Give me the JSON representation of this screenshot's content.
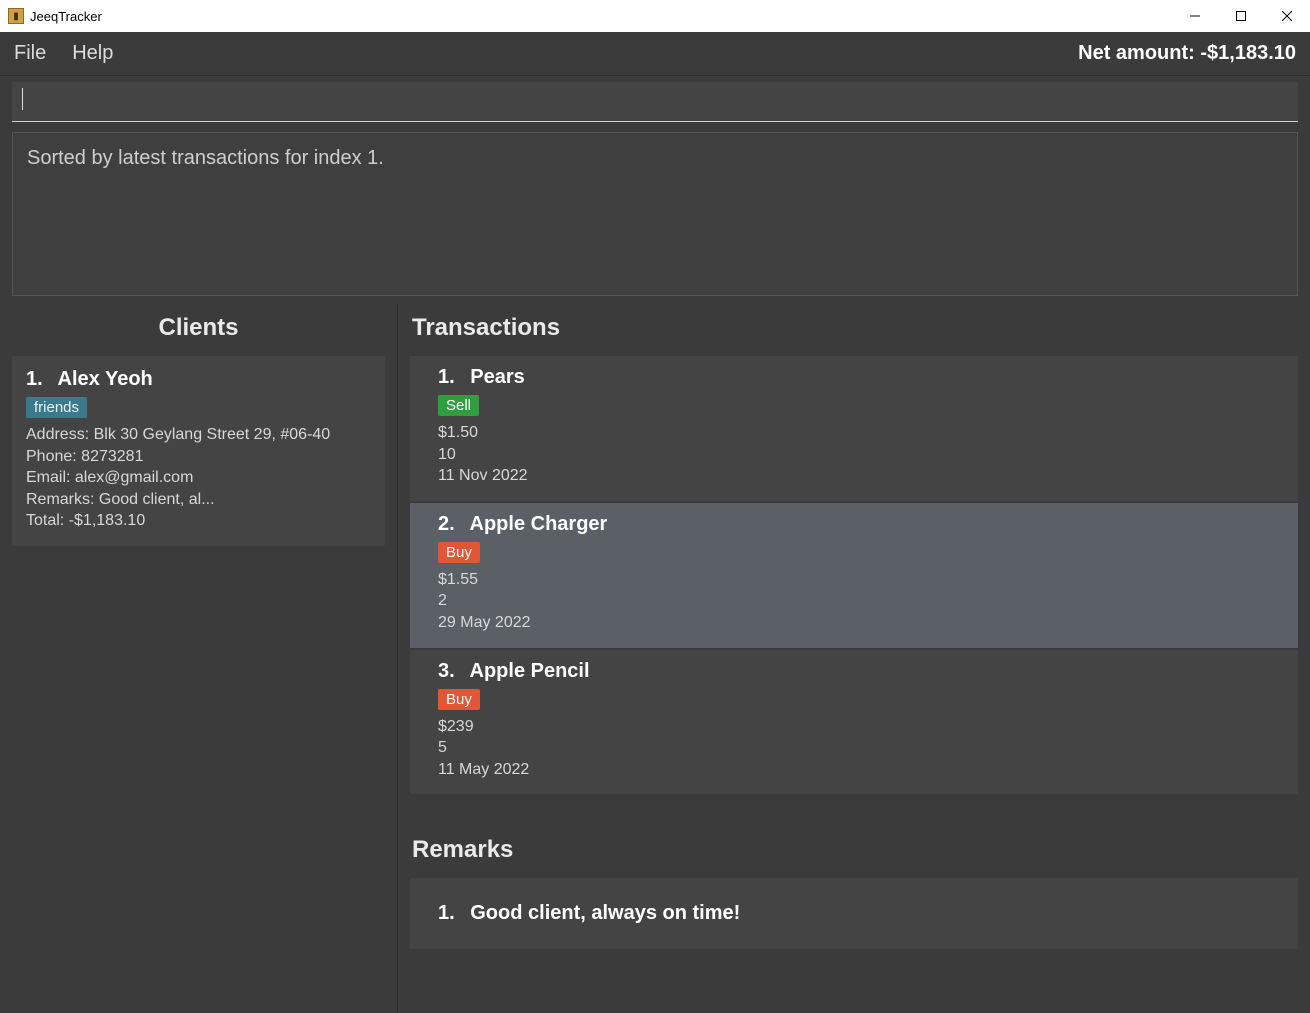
{
  "window": {
    "title": "JeeqTracker"
  },
  "menu": {
    "file": "File",
    "help": "Help"
  },
  "header": {
    "net_amount_label": "Net amount:",
    "net_amount_value": "-$1,183.10"
  },
  "command": {
    "value": ""
  },
  "status": {
    "message": "Sorted by latest transactions for index 1."
  },
  "clients": {
    "title": "Clients",
    "items": [
      {
        "index": "1.",
        "name": "Alex Yeoh",
        "tag": "friends",
        "address_label": "Address:",
        "address": "Blk 30 Geylang Street 29, #06-40",
        "phone_label": "Phone:",
        "phone": "8273281",
        "email_label": "Email:",
        "email": "alex@gmail.com",
        "remarks_label": "Remarks:",
        "remarks": "Good client, al...",
        "total_label": "Total:",
        "total": "-$1,183.10"
      }
    ]
  },
  "transactions": {
    "title": "Transactions",
    "items": [
      {
        "index": "1.",
        "name": "Pears",
        "type": "Sell",
        "price": "$1.50",
        "qty": "10",
        "date": "11 Nov 2022",
        "highlight": false
      },
      {
        "index": "2.",
        "name": "Apple Charger",
        "type": "Buy",
        "price": "$1.55",
        "qty": "2",
        "date": "29 May 2022",
        "highlight": true
      },
      {
        "index": "3.",
        "name": "Apple Pencil",
        "type": "Buy",
        "price": "$239",
        "qty": "5",
        "date": "11 May 2022",
        "highlight": false
      }
    ]
  },
  "remarks": {
    "title": "Remarks",
    "items": [
      {
        "index": "1.",
        "text": "Good client, always on time!"
      }
    ]
  }
}
